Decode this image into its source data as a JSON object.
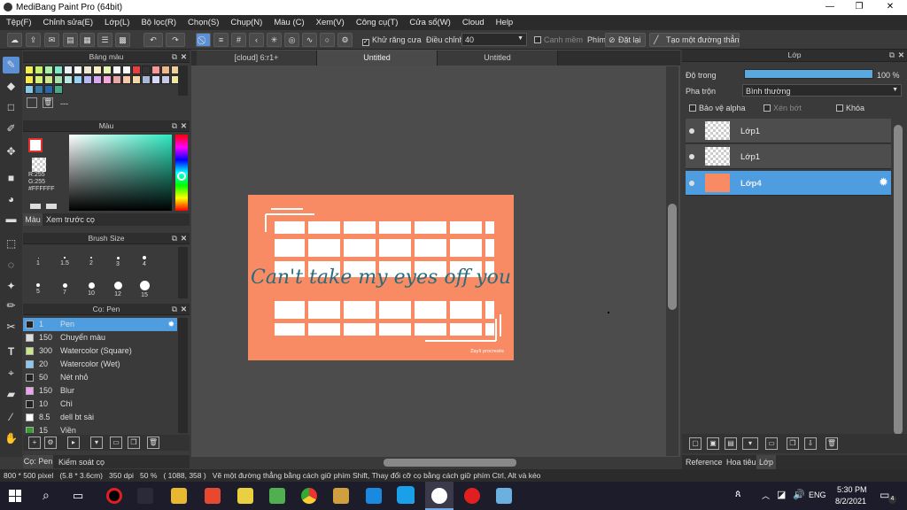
{
  "app": {
    "title": "MediBang Paint Pro (64bit)"
  },
  "window_controls": {
    "min": "—",
    "max": "❐",
    "close": "✕"
  },
  "menu": [
    "Tệp(F)",
    "Chỉnh sửa(E)",
    "Lớp(L)",
    "Bộ lọc(R)",
    "Chọn(S)",
    "Chụp(N)",
    "Màu (C)",
    "Xem(V)",
    "Công cụ(T)",
    "Cửa sổ(W)",
    "Cloud",
    "Help"
  ],
  "toolbar": {
    "antialias_label": "Khử răng cưa",
    "adjust_label": "Điều chỉnh",
    "adjust_value": "40",
    "smooth_label": "Canh mềm",
    "keys_label": "Phím",
    "reset_label": "Đặt lại",
    "straight_label": "Tạo một đường thẳng"
  },
  "palette_panel": {
    "title": "Bảng màu",
    "footer": "---",
    "colors": [
      "#f3f04c",
      "#c9f06c",
      "#a8f0a8",
      "#7fe8c8",
      "#e8f0f8",
      "#f8f8f8",
      "#f0e8d0",
      "#f8f0c0",
      "#e8f8b0",
      "#f8f8f8",
      "#f8f8f8",
      "#e84040",
      "#333333",
      "#f89898",
      "#f0b888",
      "#f0d098",
      "#f8e848",
      "#d8f078",
      "#d0e888",
      "#a8e0b0",
      "#b8e8e0",
      "#98d0f8",
      "#b8b8f8",
      "#d8a8f0",
      "#f8a8d8",
      "#e8a8a8",
      "#f8c8a8",
      "#f0d8a8",
      "#a8b8d8",
      "#d8d8f8",
      "#c8c8e8",
      "#f0e8a0",
      "#88c8e8",
      "#3878a8",
      "#2868a8",
      "#48a888"
    ]
  },
  "color_panel": {
    "title": "Màu",
    "r": "R:255",
    "g": "G:255",
    "hex": "#FFFFFF",
    "tab1": "Màu",
    "tab2": "Xem trước cọ"
  },
  "brush_size": {
    "title": "Brush Size",
    "sizes": [
      "1",
      "1.5",
      "2",
      "3",
      "4",
      "5",
      "7",
      "10",
      "12",
      "15"
    ]
  },
  "brush_panel": {
    "title": "Cọ: Pen",
    "items": [
      {
        "size": "1",
        "name": "Pen",
        "color": "#222222"
      },
      {
        "size": "150",
        "name": "Chuyển màu",
        "color": "#dddddd"
      },
      {
        "size": "300",
        "name": "Watercolor (Square)",
        "color": "#c8e888"
      },
      {
        "size": "20",
        "name": "Watercolor (Wet)",
        "color": "#88c8f8"
      },
      {
        "size": "50",
        "name": "Nét nhỏ",
        "color": "#222222"
      },
      {
        "size": "150",
        "name": "Blur",
        "color": "#f0a0f0"
      },
      {
        "size": "10",
        "name": "Chì",
        "color": "#222222"
      },
      {
        "size": "8.5",
        "name": "dell bt sài",
        "color": "#ffffff"
      },
      {
        "size": "15",
        "name": "Viền",
        "color": "#30a030"
      }
    ],
    "tab1": "Cọ: Pen",
    "tab2": "Kiếm soát cọ"
  },
  "tabs": [
    "[cloud] 6:r1+",
    "Untitled",
    "Untitled"
  ],
  "artwork": {
    "text": "Can't take my eyes off you",
    "signature": "Zayli\nprocreate"
  },
  "layer_panel": {
    "title": "Lớp",
    "opacity_label": "Độ trong",
    "opacity_value": "100 %",
    "blend_label": "Pha trộn",
    "blend_value": "Bình thường",
    "alpha_label": "Bảo vệ alpha",
    "clip_label": "Xén bớt",
    "lock_label": "Khóa",
    "layers": [
      {
        "name": "Lớp1"
      },
      {
        "name": "Lớp1"
      },
      {
        "name": "Lớp4"
      }
    ],
    "tabs": [
      "Reference",
      "Hoa tiêu",
      "Lớp"
    ]
  },
  "status": {
    "text": "800 * 500 pixel   (5.8 * 3.6cm)   350 dpi   50 %   ( 1088, 358 )   Vẽ một đường thẳng bằng cách giữ phím Shift, Thay đổi cỡ cọ bằng cách giữ phím Ctrl, Alt và kéo"
  },
  "taskbar": {
    "time": "5:30 PM",
    "date": "8/2/2021",
    "lang": "ENG",
    "badge": "4"
  }
}
